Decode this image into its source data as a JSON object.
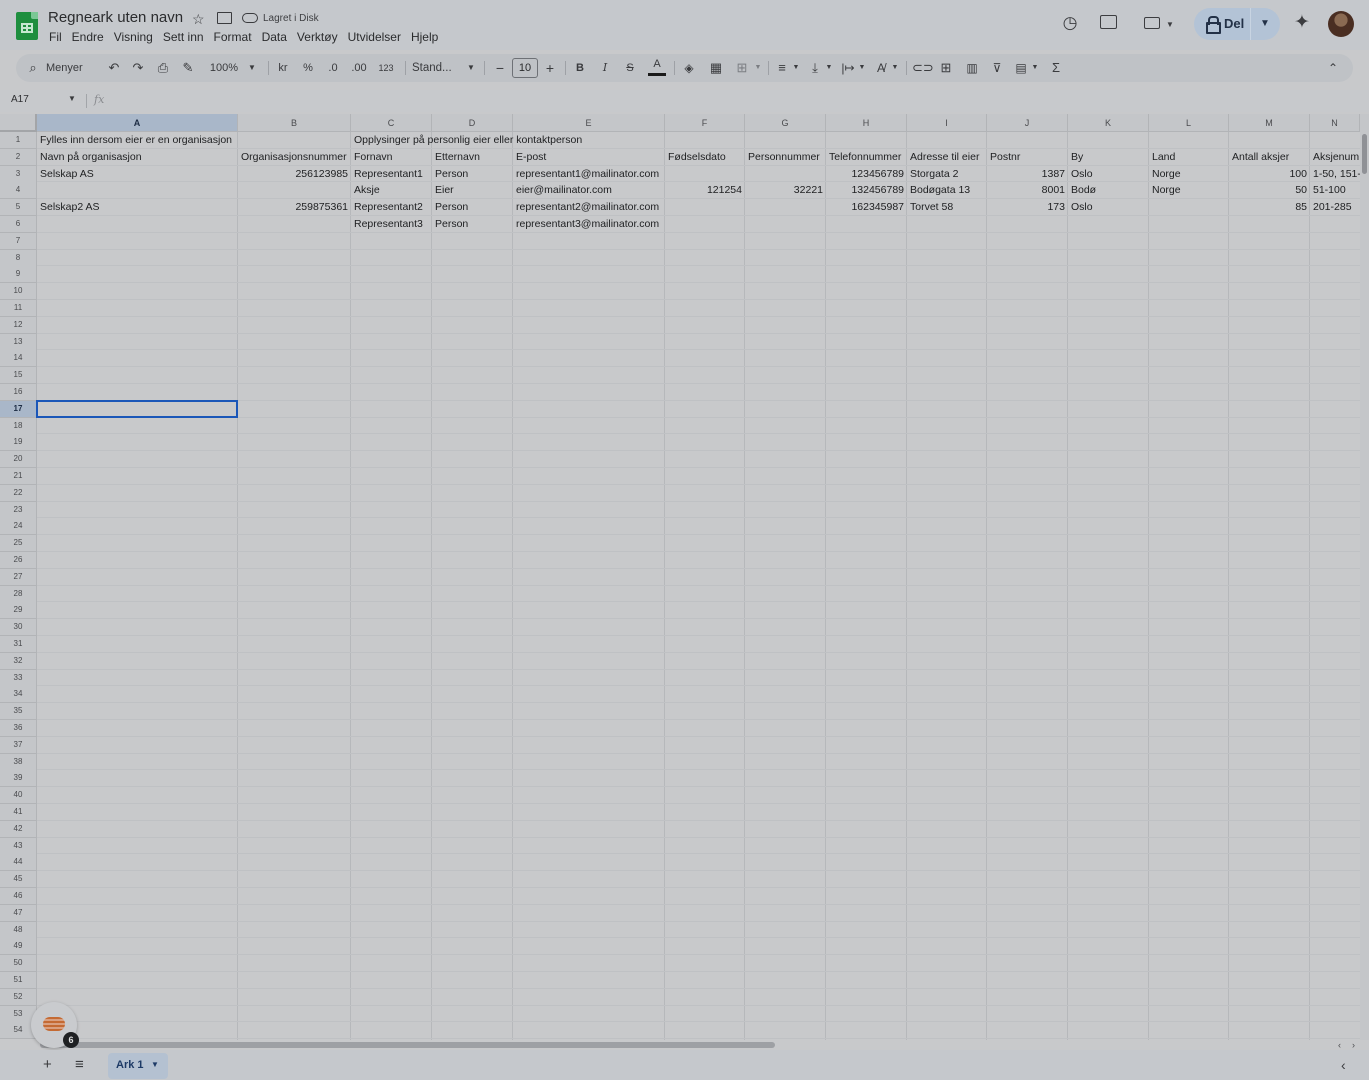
{
  "app": {
    "title": "Regneark uten navn",
    "saved_status": "Lagret i Disk",
    "share_label": "Del",
    "icons": [
      "sheets-logo",
      "star-icon",
      "move-folder-icon",
      "cloud-icon",
      "version-history-icon",
      "comment-icon",
      "meet-icon",
      "lock-icon",
      "gemini-icon"
    ]
  },
  "menu": [
    "Fil",
    "Endre",
    "Visning",
    "Sett inn",
    "Format",
    "Data",
    "Verktøy",
    "Utvidelser",
    "Hjelp"
  ],
  "toolbar": {
    "search_label": "Menyer",
    "zoom": "100%",
    "currency": "kr",
    "percent": "%",
    "dec_decrease": ".0",
    "dec_increase": ".00",
    "more_formats": "123",
    "font": "Stand...",
    "font_size": "10"
  },
  "formula_bar": {
    "name_box": "A17",
    "fx": "fx",
    "value": ""
  },
  "columns": [
    "A",
    "B",
    "C",
    "D",
    "E",
    "F",
    "G",
    "H",
    "I",
    "J",
    "K",
    "L",
    "M",
    "N"
  ],
  "selected_column": "A",
  "selected_row": 17,
  "row_count": 54,
  "cells": {
    "A1": "Fylles inn dersom eier er en organisasjon",
    "C1": "Opplysinger på personlig eier eller kontaktperson",
    "A2": "Navn på organisasjon",
    "B2": "Organisasjonsnummer",
    "C2": "Fornavn",
    "D2": "Etternavn",
    "E2": "E-post",
    "F2": "Fødselsdato",
    "G2": "Personnummer",
    "H2": "Telefonnummer",
    "I2": "Adresse til eier",
    "J2": "Postnr",
    "K2": "By",
    "L2": "Land",
    "M2": "Antall aksjer",
    "N2": "Aksjenum",
    "A3": "Selskap AS",
    "B3": "256123985",
    "C3": "Representant1",
    "D3": "Person",
    "E3": "representant1@mailinator.com",
    "H3": "123456789",
    "I3": "Storgata 2",
    "J3": "1387",
    "K3": "Oslo",
    "L3": "Norge",
    "M3": "100",
    "N3": "1-50, 151-",
    "C4": "Aksje",
    "D4": "Eier",
    "E4": "eier@mailinator.com",
    "F4": "121254",
    "G4": "32221",
    "H4": "132456789",
    "I4": "Bodøgata 13",
    "J4": "8001",
    "K4": "Bodø",
    "L4": "Norge",
    "M4": "50",
    "N4": "51-100",
    "A5": "Selskap2 AS",
    "B5": "259875361",
    "C5": "Representant2",
    "D5": "Person",
    "E5": "representant2@mailinator.com",
    "H5": "162345987",
    "I5": "Torvet 58",
    "J5": "173",
    "K5": "Oslo",
    "M5": "85",
    "N5": "201-285",
    "C6": "Representant3",
    "D6": "Person",
    "E6": "representant3@mailinator.com"
  },
  "numeric_cells": [
    "B3",
    "B5",
    "F4",
    "G4",
    "H3",
    "H4",
    "H5",
    "J3",
    "J4",
    "J5",
    "M3",
    "M4",
    "M5"
  ],
  "sheet_tabs": [
    {
      "label": "Ark 1",
      "active": true
    }
  ],
  "explore_badge": "6",
  "colors": {
    "selection": "#1a56b8",
    "share_button": "#b3c3d6",
    "sheets_green": "#1e8e3e"
  }
}
